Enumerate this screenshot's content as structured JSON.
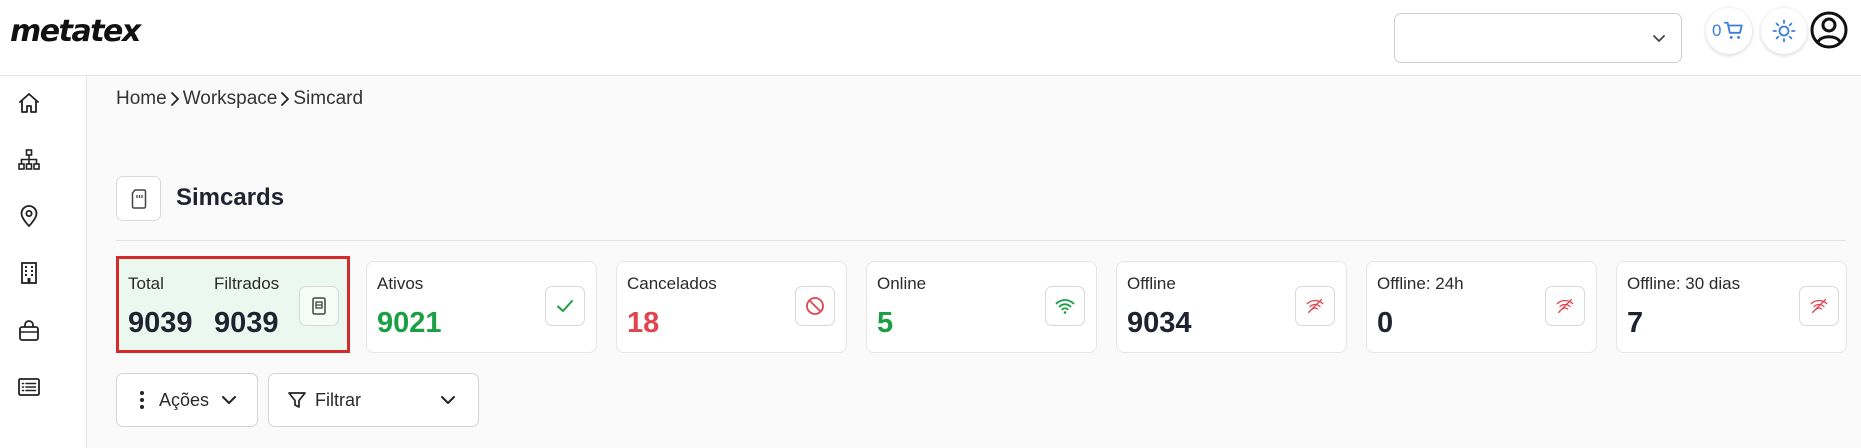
{
  "app": {
    "logo": "metatex"
  },
  "header": {
    "cart_count": "0",
    "icons": [
      "chevron-down-icon",
      "cart-icon",
      "sun-icon",
      "user-circle-icon"
    ]
  },
  "sidebar": {
    "items": [
      {
        "icon": "home-icon"
      },
      {
        "icon": "hierarchy-icon"
      },
      {
        "icon": "location-pin-icon"
      },
      {
        "icon": "building-icon"
      },
      {
        "icon": "shopping-bag-icon"
      },
      {
        "icon": "list-icon"
      }
    ]
  },
  "breadcrumb": {
    "items": [
      "Home",
      "Workspace",
      "Simcard"
    ]
  },
  "page": {
    "title": "Simcards",
    "title_icon": "simcard-icon"
  },
  "stats": {
    "total": {
      "label_total": "Total",
      "label_filtered": "Filtrados",
      "value_total": "9039",
      "value_filtered": "9039",
      "icon": "simcard-icon"
    },
    "cards": [
      {
        "label": "Ativos",
        "value": "9021",
        "value_color": "#1a9f45",
        "icon": "check-icon"
      },
      {
        "label": "Cancelados",
        "value": "18",
        "value_color": "#e0454f",
        "icon": "block-icon"
      },
      {
        "label": "Online",
        "value": "5",
        "value_color": "#1a9f45",
        "icon": "wifi-icon"
      },
      {
        "label": "Offline",
        "value": "9034",
        "value_color": "#1f2330",
        "icon": "wifi-off-icon"
      },
      {
        "label": "Offline: 24h",
        "value": "0",
        "value_color": "#1f2330",
        "icon": "wifi-off-icon"
      },
      {
        "label": "Offline: 30 dias",
        "value": "7",
        "value_color": "#1f2330",
        "icon": "wifi-off-icon"
      }
    ]
  },
  "actions": {
    "acoes_label": "Ações",
    "filtrar_label": "Filtrar"
  },
  "colors": {
    "accent_blue": "#3b7de0",
    "green": "#1a9f45",
    "red": "#e0454f",
    "highlight_border": "#d42a2a"
  }
}
